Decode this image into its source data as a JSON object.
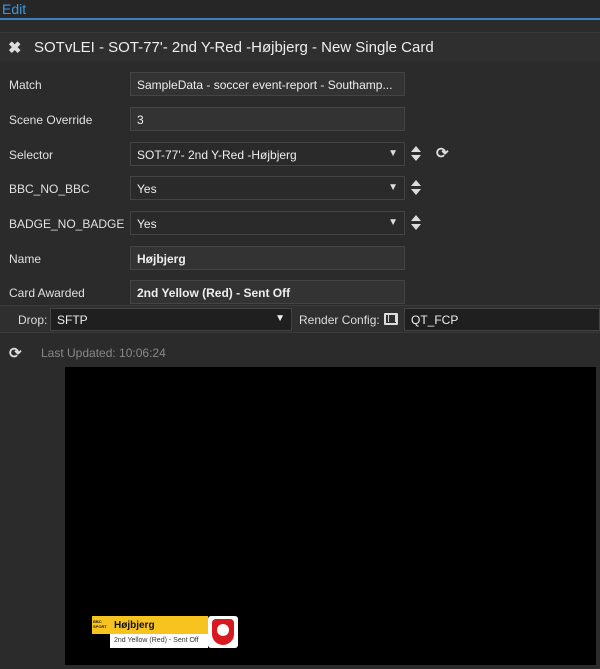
{
  "topbar": {
    "edit_label": "Edit"
  },
  "title": "SOTvLEI - SOT-77'- 2nd Y-Red -Højbjerg - New Single Card",
  "form": {
    "match": {
      "label": "Match",
      "value": "SampleData - soccer event-report - Southamp..."
    },
    "scene_override": {
      "label": "Scene Override",
      "value": "3"
    },
    "selector": {
      "label": "Selector",
      "value": "SOT-77'- 2nd Y-Red -Højbjerg"
    },
    "bbc_no_bbc": {
      "label": "BBC_NO_BBC",
      "value": "Yes"
    },
    "badge_no_badge": {
      "label": "BADGE_NO_BADGE",
      "value": "Yes"
    },
    "name": {
      "label": "Name",
      "value": "Højbjerg"
    },
    "card_awarded": {
      "label": "Card Awarded",
      "value": "2nd Yellow (Red) - Sent Off"
    }
  },
  "dropbar": {
    "drop_label": "Drop:",
    "drop_value": "SFTP",
    "render_label": "Render Config:",
    "render_value": "QT_FCP"
  },
  "last_updated": "Last Updated: 10:06:24",
  "lower_third": {
    "logo_text": "BBC SPORT",
    "name": "Højbjerg",
    "card": "2nd Yellow (Red) - Sent Off"
  },
  "colors": {
    "accent": "#3d97e0",
    "lower_third_yellow": "#f7c31e",
    "badge_red": "#d71920"
  },
  "icons": [
    "close-icon",
    "caret-down-icon",
    "up-down-icon",
    "refresh-icon",
    "film-icon"
  ]
}
